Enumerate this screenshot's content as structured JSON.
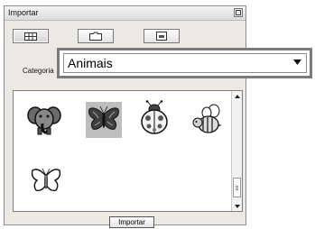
{
  "window": {
    "title": "Importar"
  },
  "view_buttons": [
    {
      "name": "grid-view",
      "icon": "grid-icon",
      "active": true
    },
    {
      "name": "folder-view",
      "icon": "folder-icon",
      "active": false
    },
    {
      "name": "card-view",
      "icon": "card-icon",
      "active": false
    }
  ],
  "category": {
    "label": "Categoria",
    "value": "Animais"
  },
  "thumbnails": [
    {
      "name": "elephant",
      "icon": "elephant-embroidery-icon",
      "selected": false
    },
    {
      "name": "butterfly-dark",
      "icon": "butterfly-embroidery-icon",
      "selected": true
    },
    {
      "name": "ladybug",
      "icon": "ladybug-embroidery-icon",
      "selected": false
    },
    {
      "name": "bee",
      "icon": "bee-embroidery-icon",
      "selected": false
    },
    {
      "name": "butterfly-outline",
      "icon": "butterfly-outline-embroidery-icon",
      "selected": false
    }
  ],
  "actions": {
    "import_label": "Importar"
  },
  "colors": {
    "panel_bg": "#ece9e4",
    "highlight_outline": "#7b7b7b",
    "selected_thumb_bg": "#bdbdbd"
  }
}
